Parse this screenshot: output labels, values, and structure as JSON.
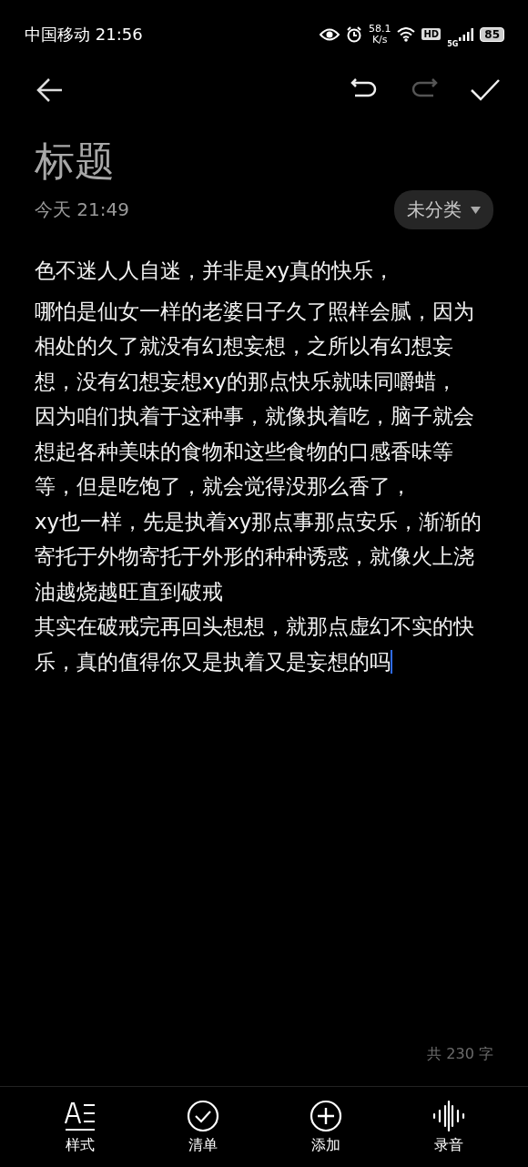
{
  "status_bar": {
    "carrier_time": "中国移动 21:56",
    "speed_value": "58.1",
    "speed_unit": "K/s",
    "hd": "HD",
    "network": "5G",
    "battery": "85"
  },
  "toolbar": {
    "actions": [
      {
        "kind": "undo",
        "disabled": false
      },
      {
        "kind": "redo",
        "disabled": true
      },
      {
        "kind": "done",
        "disabled": false
      }
    ]
  },
  "note": {
    "title": "标题",
    "date": "今天 21:49",
    "category": "未分类",
    "paragraphs": [
      "色不迷人人自迷，并非是xy真的快乐，",
      "哪怕是仙女一样的老婆日子久了照样会腻，因为相处的久了就没有幻想妄想，之所以有幻想妄想，没有幻想妄想xy的那点快乐就味同嚼蜡，",
      "因为咱们执着于这种事，就像执着吃，脑子就会想起各种美味的食物和这些食物的口感香味等等，但是吃饱了，就会觉得没那么香了，",
      "xy也一样，先是执着xy那点事那点安乐，渐渐的寄托于外物寄托于外形的种种诱惑，就像火上浇油越烧越旺直到破戒",
      "其实在破戒完再回头想想，就那点虚幻不实的快乐，真的值得你又是执着又是妄想的吗"
    ],
    "word_count": "共 230 字"
  },
  "bottom_bar": [
    {
      "kind": "style",
      "label": "样式"
    },
    {
      "kind": "checklist",
      "label": "清单"
    },
    {
      "kind": "add",
      "label": "添加"
    },
    {
      "kind": "record",
      "label": "录音"
    }
  ]
}
